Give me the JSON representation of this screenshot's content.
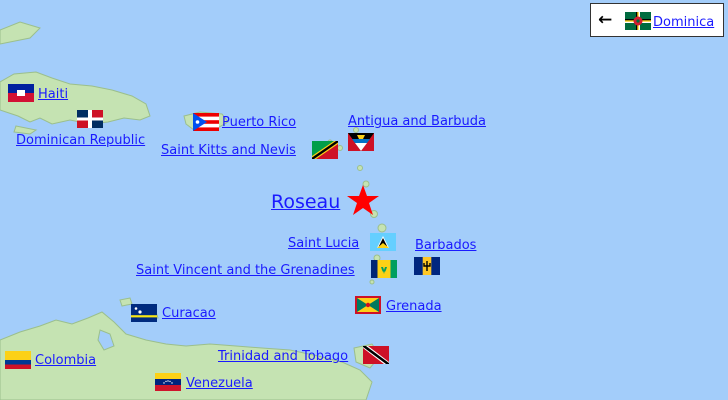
{
  "back": {
    "arrow": "←",
    "flag_icon": "dominica-flag-icon",
    "label": "Dominica"
  },
  "capital": {
    "label": "Roseau",
    "marker_icon": "red-star-icon",
    "marker_color": "#ff0000"
  },
  "colors": {
    "sea": "#a3cdfa",
    "land": "#c5e3b2",
    "link": "#1a1aff"
  },
  "places": [
    {
      "label": "Haiti",
      "flag_icon": "haiti-flag-icon"
    },
    {
      "label": "Dominican Republic",
      "flag_icon": "dominican-republic-flag-icon"
    },
    {
      "label": "Puerto Rico",
      "flag_icon": "puerto-rico-flag-icon"
    },
    {
      "label": "Antigua and Barbuda",
      "flag_icon": "antigua-and-barbuda-flag-icon"
    },
    {
      "label": "Saint Kitts and Nevis",
      "flag_icon": "saint-kitts-and-nevis-flag-icon"
    },
    {
      "label": "Saint Lucia",
      "flag_icon": "saint-lucia-flag-icon"
    },
    {
      "label": "Barbados",
      "flag_icon": "barbados-flag-icon"
    },
    {
      "label": "Saint Vincent and the Grenadines",
      "flag_icon": "saint-vincent-flag-icon"
    },
    {
      "label": "Grenada",
      "flag_icon": "grenada-flag-icon"
    },
    {
      "label": "Curacao",
      "flag_icon": "curacao-flag-icon"
    },
    {
      "label": "Trinidad and Tobago",
      "flag_icon": "trinidad-and-tobago-flag-icon"
    },
    {
      "label": "Colombia",
      "flag_icon": "colombia-flag-icon"
    },
    {
      "label": "Venezuela",
      "flag_icon": "venezuela-flag-icon"
    }
  ]
}
